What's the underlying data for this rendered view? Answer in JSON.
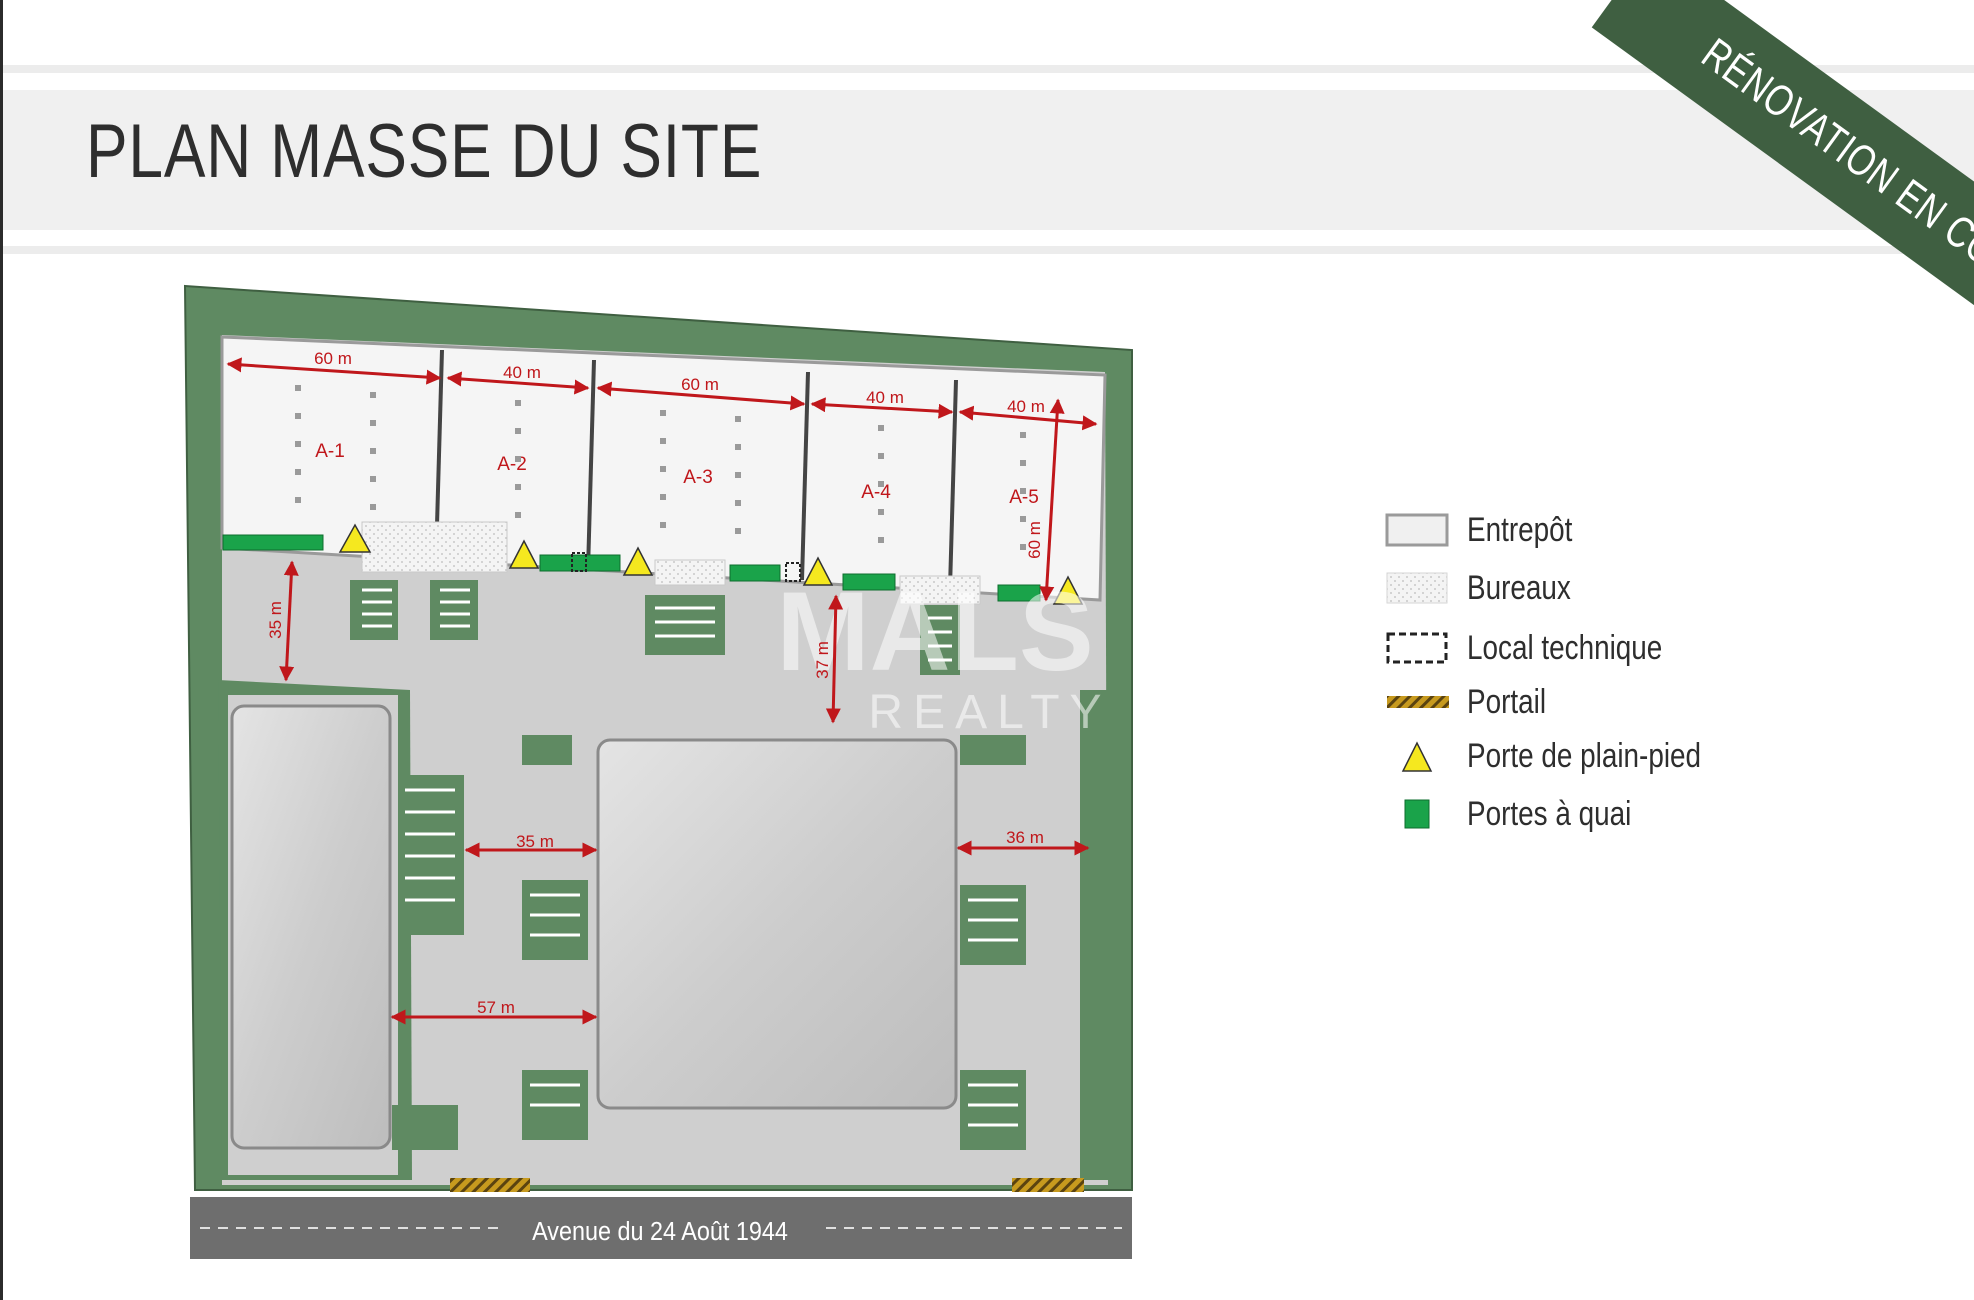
{
  "header": {
    "title": "PLAN MASSE DU SITE",
    "ribbon": "RÉNOVATION EN COURS"
  },
  "plan": {
    "units": [
      "A-1",
      "A-2",
      "A-3",
      "A-4",
      "A-5"
    ],
    "dimensions": {
      "a1_width": "60 m",
      "a2_width": "40 m",
      "a3_width": "60 m",
      "a4_width": "40 m",
      "a5_width": "40 m",
      "a5_depth": "60 m",
      "yard_left": "35 m",
      "yard_center": "37 m",
      "gap_between": "35 m",
      "gap_right": "36 m",
      "gap_bottom": "57 m"
    },
    "street": "Avenue du 24 Août 1944",
    "watermark": {
      "line1": "MALS",
      "line2": "REALTY"
    }
  },
  "legend": {
    "items": [
      {
        "icon": "warehouse-swatch",
        "label": "Entrepôt"
      },
      {
        "icon": "office-swatch",
        "label": "Bureaux"
      },
      {
        "icon": "technical-room-swatch",
        "label": "Local technique"
      },
      {
        "icon": "gate-swatch",
        "label": "Portail"
      },
      {
        "icon": "ground-level-door-triangle",
        "label": "Porte de plain-pied"
      },
      {
        "icon": "loading-dock-square",
        "label": "Portes à quai"
      }
    ]
  },
  "colors": {
    "green_border": "#5f8a62",
    "ribbon": "#3f5f41",
    "yard": "#cfcfcf",
    "dimension": "#c0171b",
    "dock_door": "#1aa34a",
    "door_triangle": "#f5e81f",
    "gate": "#c79a1e"
  }
}
